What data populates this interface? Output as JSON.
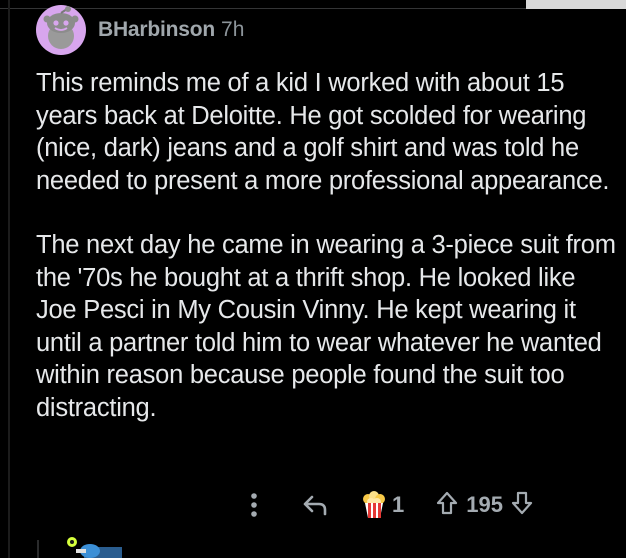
{
  "comment": {
    "author": "BHarbinson",
    "age": "7h",
    "paragraphs": [
      "This reminds me of a kid I worked with about 15 years back at Deloitte. He got scolded for wearing (nice, dark) jeans and a golf shirt and was told he needed to present a more professional appearance.",
      "The next day he came in wearing a 3-piece suit from the '70s he bought at a thrift shop. He looked like Joe Pesci in My Cousin Vinny. He kept wearing it until a partner told him to wear whatever he wanted within reason because people found the suit too distracting."
    ],
    "award_count": "1",
    "score": "195"
  },
  "icons": {
    "more": "vertical-dots-icon",
    "reply": "reply-arrow-icon",
    "award": "popcorn-icon",
    "upvote": "upvote-arrow-icon",
    "downvote": "downvote-arrow-icon"
  },
  "colors": {
    "background": "#000000",
    "avatar_bg": "#d8a6ee",
    "text": "#e6e8ea",
    "meta": "#a0a7ac"
  }
}
